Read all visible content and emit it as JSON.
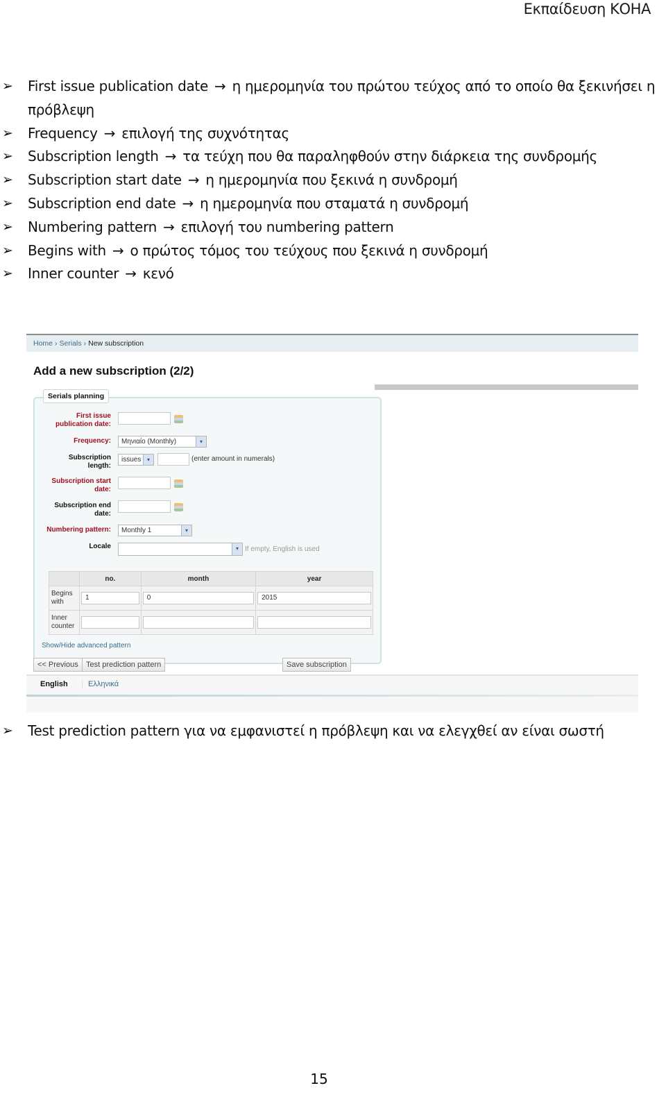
{
  "header": {
    "title": "Εκπαίδευση ΚΟΗΑ"
  },
  "bullets": [
    {
      "term": "First issue publication date",
      "desc": "η ημερομηνία του πρώτου τεύχος από το οποίο θα ξεκινήσει η πρόβλεψη"
    },
    {
      "term": "Frequency",
      "desc": "επιλογή της συχνότητας"
    },
    {
      "term": "Subscription length",
      "desc": "τα τεύχη που θα παραληφθούν στην διάρκεια της συνδρομής"
    },
    {
      "term": "Subscription start date",
      "desc": "η ημερομηνία που ξεκινά η συνδρομή"
    },
    {
      "term": "Subscription end date",
      "desc": "η ημερομηνία που σταματά η συνδρομή"
    },
    {
      "term": "Numbering pattern",
      "desc": "επιλογή του numbering pattern"
    },
    {
      "term": "Begins with",
      "desc": "ο πρώτος τόμος του τεύχους που ξεκινά η συνδρομή"
    },
    {
      "term": "Inner counter",
      "desc": "κενό"
    }
  ],
  "icons": {
    "bullet": "➢",
    "arrow": "→",
    "dropdown": "▾"
  },
  "screenshot": {
    "breadcrumb": {
      "home": "Home",
      "serials": "Serials",
      "current": "New subscription",
      "sep": "›"
    },
    "title": "Add a new subscription (2/2)",
    "fieldset_legend": "Serials planning",
    "fields": {
      "first_issue": {
        "label_1": "First issue",
        "label_2": "publication date:",
        "value": ""
      },
      "frequency": {
        "label": "Frequency:",
        "value": "Μηνιαίο (Monthly)"
      },
      "sub_length": {
        "label_1": "Subscription",
        "label_2": "length:",
        "unit": "issues",
        "value": "",
        "hint": "(enter amount in numerals)"
      },
      "start_date": {
        "label_1": "Subscription start",
        "label_2": "date:",
        "value": ""
      },
      "end_date": {
        "label_1": "Subscription end",
        "label_2": "date:",
        "value": ""
      },
      "numbering": {
        "label": "Numbering pattern:",
        "value": "Monthly 1"
      },
      "locale": {
        "label": "Locale",
        "value": "",
        "hint": "If empty, English is used"
      }
    },
    "pattern_table": {
      "headers": [
        "no.",
        "month",
        "year"
      ],
      "rows": [
        {
          "label_1": "Begins",
          "label_2": "with",
          "values": [
            "1",
            "0",
            "2015"
          ]
        },
        {
          "label_1": "Inner",
          "label_2": "counter",
          "values": [
            "",
            "",
            ""
          ]
        }
      ]
    },
    "advanced_link": "Show/Hide advanced pattern",
    "buttons": {
      "previous": "<< Previous",
      "test": "Test prediction pattern",
      "save": "Save subscription"
    },
    "languages": {
      "english": "English",
      "greek": "Ελληνικά"
    },
    "colors": {
      "required_label": "#a01020",
      "link": "#3a6b8c",
      "fieldset_bg": "#f4f8f9"
    }
  },
  "after_note": {
    "term": "Test prediction pattern",
    "desc": "για να εμφανιστεί η πρόβλεψη και να ελεγχθεί αν είναι σωστή"
  },
  "page_number": "15"
}
